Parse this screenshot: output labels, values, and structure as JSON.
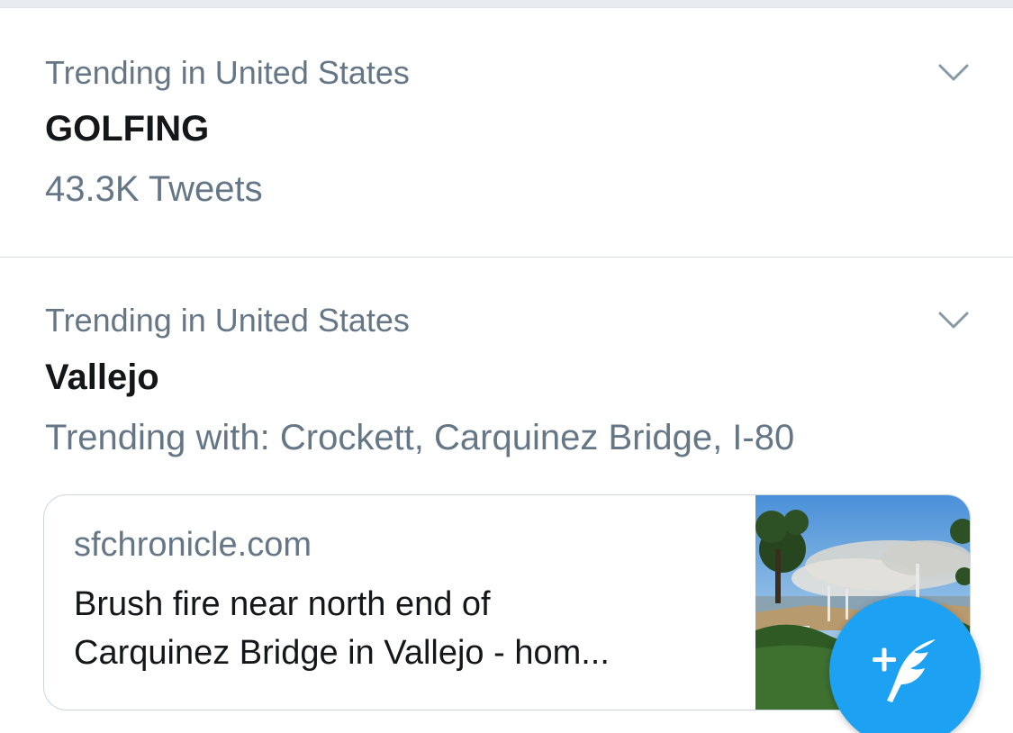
{
  "trends": [
    {
      "context": "Trending in United States",
      "title": "GOLFING",
      "meta": "43.3K Tweets"
    },
    {
      "context": "Trending in United States",
      "title": "Vallejo",
      "meta": "Trending with: Crockett, Carquinez Bridge, I-80",
      "card": {
        "domain": "sfchronicle.com",
        "headline_line1": "Brush fire near north end of",
        "headline_line2": "Carquinez Bridge in Vallejo - hom..."
      }
    }
  ],
  "icons": {
    "chevron": "chevron-down-icon",
    "compose": "compose-tweet-icon"
  },
  "colors": {
    "accent": "#1da1f2",
    "primary_text": "#14171a",
    "secondary_text": "#657786",
    "divider": "#d6dbdf"
  }
}
